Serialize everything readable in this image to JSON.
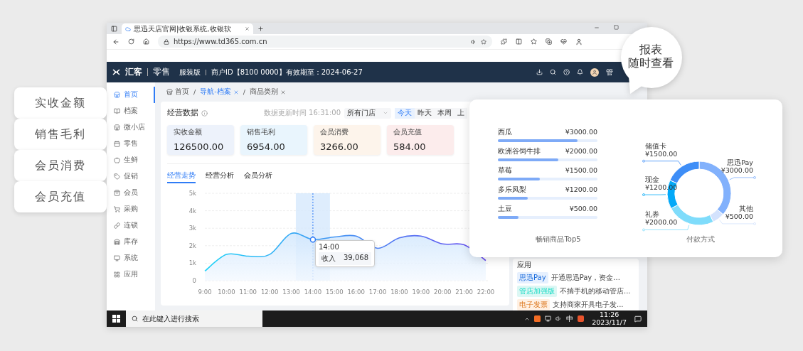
{
  "browser": {
    "tab_title": "思迅天店官网|收银系统,收银软",
    "url": "https://www.td365.com.cn"
  },
  "header": {
    "brand": "汇客",
    "product": "零售",
    "edition": "服装版",
    "merchant": "商户ID【8100 0000】有效期至：2024-06-27",
    "user": "管"
  },
  "sidebar": {
    "items": [
      {
        "label": "首页",
        "selected": true
      },
      {
        "label": "档案",
        "selected": false
      },
      {
        "label": "微小店",
        "selected": false
      },
      {
        "label": "零售",
        "selected": false
      },
      {
        "label": "生鲜",
        "selected": false
      },
      {
        "label": "促销",
        "selected": false
      },
      {
        "label": "会员",
        "selected": false
      },
      {
        "label": "采购",
        "selected": false
      },
      {
        "label": "连锁",
        "selected": false
      },
      {
        "label": "库存",
        "selected": false
      },
      {
        "label": "系统",
        "selected": false
      },
      {
        "label": "应用",
        "selected": false
      }
    ]
  },
  "breadcrumbs": [
    {
      "label": "首页",
      "selected": false,
      "closable": false
    },
    {
      "separator": "/",
      "label": "导航-档案",
      "selected": true,
      "closable": true
    },
    {
      "separator": "/",
      "label": "商品类别",
      "selected": false,
      "closable": true
    }
  ],
  "overview": {
    "title": "经营数据",
    "updated": "数据更新时间 16:31:00",
    "store_select": "所有门店",
    "periods": [
      {
        "label": "今天",
        "selected": true
      },
      {
        "label": "昨天",
        "selected": false
      },
      {
        "label": "本周",
        "selected": false
      },
      {
        "label": "上",
        "selected": false
      }
    ],
    "metrics": [
      {
        "label": "实收金额",
        "value": "126500.00",
        "color": "#edf2fb"
      },
      {
        "label": "销售毛利",
        "value": "6954.00",
        "color": "#e9f5fd"
      },
      {
        "label": "会员消费",
        "value": "3266.00",
        "color": "#fdf4eb"
      },
      {
        "label": "会员充值",
        "value": "584.00",
        "color": "#fcecec"
      }
    ]
  },
  "analysis_tabs": [
    {
      "label": "经营走势",
      "selected": true
    },
    {
      "label": "经营分析",
      "selected": false
    },
    {
      "label": "会员分析",
      "selected": false
    }
  ],
  "trend": {
    "chart_data": {
      "type": "area",
      "grid": true,
      "categories": [
        "9:00",
        "10:00",
        "11:00",
        "12:00",
        "13:00",
        "14:00",
        "15:00",
        "16:00",
        "17:00",
        "18:00",
        "19:00",
        "20:00",
        "21:00",
        "22:00"
      ],
      "series": [
        {
          "name": "收入",
          "values": [
            550,
            1500,
            1400,
            1500,
            2700,
            2350,
            2500,
            2550,
            1850,
            2450,
            2550,
            2100,
            2050,
            1150
          ]
        }
      ],
      "ylim": [
        0,
        5000
      ],
      "ref_lines": [
        {
          "axis": "x",
          "value": "14:00"
        }
      ],
      "yticks": [
        {
          "value": 0,
          "label": "0"
        },
        {
          "value": 1000,
          "label": "1k"
        },
        {
          "value": 2000,
          "label": "2k"
        },
        {
          "value": 3000,
          "label": "3k"
        },
        {
          "value": 4000,
          "label": "4k"
        },
        {
          "value": 5000,
          "label": "5k"
        }
      ]
    },
    "tooltip": {
      "time": "14:00",
      "value": "39,068"
    }
  },
  "apps": {
    "title": "应用",
    "items": [
      {
        "tag": "思迅Pay",
        "color": "#e6f0fe",
        "desc": "开通思迅Pay，资金..."
      },
      {
        "tag": "管店加强版",
        "color": "#dcf7f4",
        "desc": "不揣手机的移动管店..."
      },
      {
        "tag": "电子发票",
        "color": "#fff0e3",
        "desc": "支持商家开具电子发..."
      }
    ]
  },
  "taskbar": {
    "search_placeholder": "在此键入进行搜索",
    "ime": "中",
    "time": "11:26",
    "date": "2023/11/7"
  },
  "callouts": [
    "实收金额",
    "销售毛利",
    "会员消费",
    "会员充值"
  ],
  "bubble": [
    "报表",
    "随时查看"
  ],
  "popup": {
    "top_products": {
      "title": "畅销商品Top5",
      "items": [
        {
          "name": "西瓜",
          "amount": "¥3000.00",
          "level": 0.8
        },
        {
          "name": "欧洲谷饲牛排",
          "amount": "¥2000.00",
          "level": 0.61
        },
        {
          "name": "草莓",
          "amount": "¥1500.00",
          "level": 0.42
        },
        {
          "name": "多乐凤梨",
          "amount": "¥1200.00",
          "level": 0.3
        },
        {
          "name": "土豆",
          "amount": "¥500.00",
          "level": 0.21
        }
      ]
    },
    "payment": {
      "chart_data": {
        "type": "donut",
        "title": "付款方式",
        "categories": [
          "思迅Pay",
          "其他",
          "礼券",
          "现金",
          "储值卡"
        ],
        "values": [
          3000,
          500,
          2000,
          1200,
          1500
        ],
        "value_labels": [
          "¥3000.00",
          "¥500.00",
          "¥2000.00",
          "¥1200.00",
          "¥1500.00"
        ]
      }
    }
  }
}
